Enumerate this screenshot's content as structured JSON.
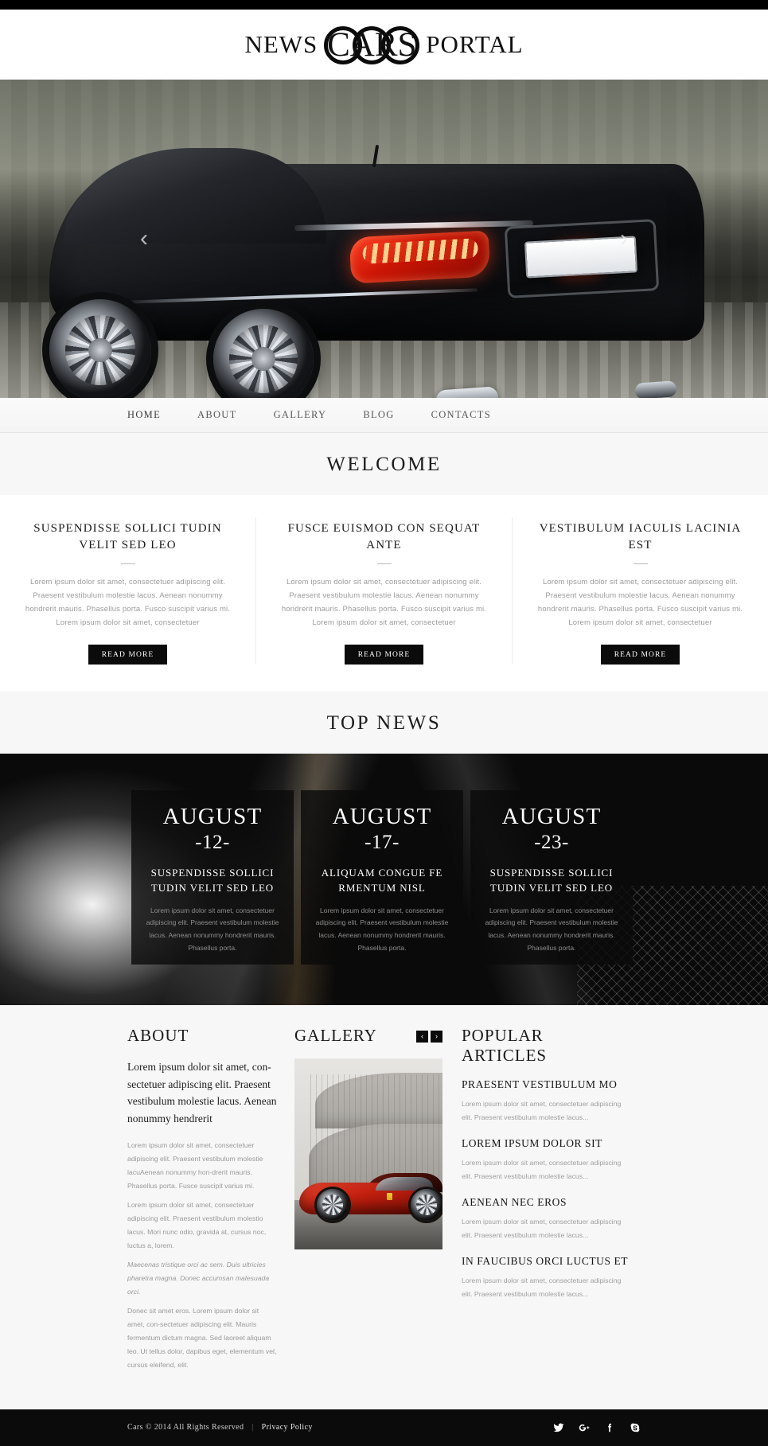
{
  "site": {
    "logo_left": "NEWS",
    "logo_center": "CARS",
    "logo_right": "PORTAL"
  },
  "hero": {
    "prev_icon": "‹",
    "next_icon": "›",
    "image_alt": "black luxury coupe rear view driving on road"
  },
  "nav": {
    "items": [
      {
        "label": "HOME"
      },
      {
        "label": "ABOUT"
      },
      {
        "label": "GALLERY"
      },
      {
        "label": "BLOG"
      },
      {
        "label": "CONTACTS"
      }
    ]
  },
  "welcome": {
    "title": "WELCOME",
    "columns": [
      {
        "heading": "SUSPENDISSE SOLLICI TUDIN VELIT SED LEO",
        "text": "Lorem ipsum dolor sit amet, consectetuer adipiscing elit. Praesent vestibulum molestie lacus. Aenean nonummy hondrerit mauris. Phasellus porta. Fusco suscipit varius mi. Lorem ipsum dolor sit amet, consectetuer",
        "button": "READ MORE"
      },
      {
        "heading": "FUSCE EUISMOD CON SEQUAT ANTE",
        "text": "Lorem ipsum dolor sit amet, consectetuer adipiscing elit. Praesent vestibulum molestie lacus. Aenean nonummy hondrerit mauris. Phasellus porta. Fusco suscipit varius mi. Lorem ipsum dolor sit amet, consectetuer",
        "button": "READ MORE"
      },
      {
        "heading": "VESTIBULUM IACULIS LACINIA EST",
        "text": "Lorem ipsum dolor sit amet, consectetuer adipiscing elit. Praesent vestibulum molestie lacus. Aenean nonummy hondrerit mauris. Phasellus porta. Fusco suscipit varius mi. Lorem ipsum dolor sit amet, consectetuer",
        "button": "READ MORE"
      }
    ]
  },
  "topnews": {
    "title": "TOP NEWS",
    "cards": [
      {
        "month": "AUGUST",
        "day": "-12-",
        "heading": "SUSPENDISSE SOLLICI TUDIN VELIT SED LEO",
        "text": "Lorem ipsum dolor sit amet, consectetuer adipiscing elit. Praesent vestibulum molestie lacus. Aenean nonummy hondrerit mauris. Phasellus porta."
      },
      {
        "month": "AUGUST",
        "day": "-17-",
        "heading": "ALIQUAM CONGUE FE RMENTUM NISL",
        "text": "Lorem ipsum dolor sit amet, consectetuer adipiscing elit. Praesent vestibulum molestie lacus. Aenean nonummy hondrerit mauris. Phasellus porta."
      },
      {
        "month": "AUGUST",
        "day": "-23-",
        "heading": "SUSPENDISSE SOLLICI TUDIN VELIT SED LEO",
        "text": "Lorem ipsum dolor sit amet, consectetuer adipiscing elit. Praesent vestibulum molestie lacus. Aenean nonummy hondrerit mauris. Phasellus porta."
      }
    ]
  },
  "about": {
    "title": "ABOUT",
    "lead": "Lorem ipsum dolor sit amet, con-sectetuer adipiscing elit. Praesent vestibulum molestie lacus. Aenean nonummy hendrerit",
    "paragraphs": [
      "Lorem ipsum dolor sit amet, consectetuer adipiscing elit. Praesent vestibulum molestie lacuAenean nonummy hon-drerit mauris. Phasellus porta. Fusce suscipit varius mi.",
      "Lorem ipsum dolor sit amet, consectetuer adipiscing elit. Praesent vestibulum molestio lacus. Mori nunc odio, gravida at, cursus noc, luctus a, lorem.",
      "Maecenas tristique orci ac sem. Duis ultricies pharetra magna. Donec accumsan malesuada orci.",
      "Donec sit amet eros. Lorem ipsum dolor sit amet, con-sectetuer adipiscing elit. Mauris fermentum dictum magna. Sed laoreet aliquam leo. Ut tellus dolor, dapibus eget, elementum vel, cursus eleifend, elit."
    ]
  },
  "gallery": {
    "title": "GALLERY",
    "prev_icon": "‹",
    "next_icon": "›",
    "image_alt": "red sports car in front of curved concrete building"
  },
  "popular": {
    "title": "POPULAR ARTICLES",
    "items": [
      {
        "heading": "PRAESENT VESTIBULUM MO",
        "text": "Lorem ipsum dolor sit amet, consectetuer adipiscing elit. Praesent vestibulum molestie lacus..."
      },
      {
        "heading": "LOREM IPSUM DOLOR SIT",
        "text": "Lorem ipsum dolor sit amet, consectetuer adipiscing elit. Praesent vestibulum molestie lacus..."
      },
      {
        "heading": "AENEAN NEC EROS",
        "text": "Lorem ipsum dolor sit amet, consectetuer adipiscing elit. Praesent vestibulum molestie lacus..."
      },
      {
        "heading": "IN FAUCIBUS ORCI LUCTUS ET",
        "text": "Lorem ipsum dolor sit amet, consectetuer adipiscing elit. Praesent vestibulum molestie lacus..."
      }
    ]
  },
  "footer": {
    "copyright": "Cars © 2014 All Rights Reserved",
    "separator": "|",
    "privacy": "Privacy Policy",
    "socials": [
      {
        "name": "twitter"
      },
      {
        "name": "google-plus"
      },
      {
        "name": "facebook"
      },
      {
        "name": "skype"
      }
    ]
  },
  "colors": {
    "accent_dark": "#0b0b0b",
    "band_bg": "#f7f7f7",
    "muted_text": "#9b9b9b"
  }
}
